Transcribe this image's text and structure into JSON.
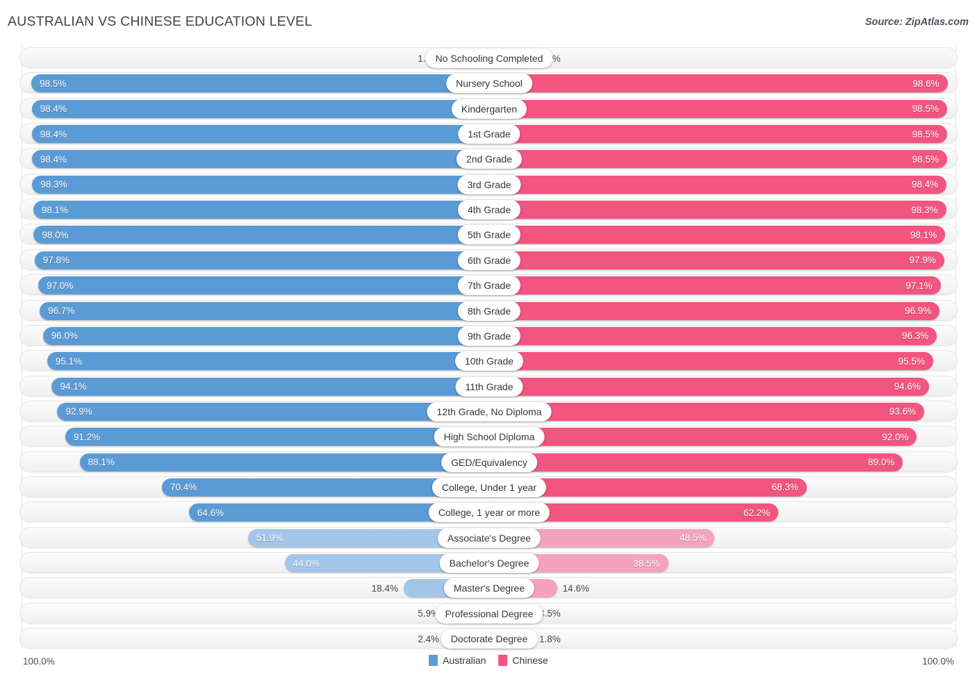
{
  "header": {
    "title": "AUSTRALIAN VS CHINESE EDUCATION LEVEL",
    "source": "Source: ZipAtlas.com"
  },
  "footer": {
    "axis_left": "100.0%",
    "axis_right": "100.0%",
    "legend": [
      {
        "label": "Australian",
        "color": "#5b9bd5"
      },
      {
        "label": "Chinese",
        "color": "#f2557f"
      }
    ]
  },
  "colors": {
    "australian_strong": "#5b9bd5",
    "australian_light": "#a3c6e8",
    "chinese_strong": "#f2557f",
    "chinese_light": "#f4a2bf",
    "track": "#f4f4f4",
    "label_bg": "#ffffff"
  },
  "chart_data": {
    "type": "bar",
    "subtype": "diverging-paired-bar",
    "title": "AUSTRALIAN VS CHINESE EDUCATION LEVEL",
    "xlabel": "",
    "ylabel": "",
    "xlim": [
      0,
      100
    ],
    "grid": true,
    "legend_position": "bottom-center",
    "categories": [
      "No Schooling Completed",
      "Nursery School",
      "Kindergarten",
      "1st Grade",
      "2nd Grade",
      "3rd Grade",
      "4th Grade",
      "5th Grade",
      "6th Grade",
      "7th Grade",
      "8th Grade",
      "9th Grade",
      "10th Grade",
      "11th Grade",
      "12th Grade, No Diploma",
      "High School Diploma",
      "GED/Equivalency",
      "College, Under 1 year",
      "College, 1 year or more",
      "Associate's Degree",
      "Bachelor's Degree",
      "Master's Degree",
      "Professional Degree",
      "Doctorate Degree"
    ],
    "series": [
      {
        "name": "Australian",
        "side": "left",
        "color": "#5b9bd5",
        "values": [
          1.6,
          98.5,
          98.4,
          98.4,
          98.4,
          98.3,
          98.1,
          98.0,
          97.8,
          97.0,
          96.7,
          96.0,
          95.1,
          94.1,
          92.9,
          91.2,
          88.1,
          70.4,
          64.6,
          51.9,
          44.0,
          18.4,
          5.9,
          2.4
        ],
        "labels": [
          "1.6%",
          "98.5%",
          "98.4%",
          "98.4%",
          "98.4%",
          "98.3%",
          "98.1%",
          "98.0%",
          "97.8%",
          "97.0%",
          "96.7%",
          "96.0%",
          "95.1%",
          "94.1%",
          "92.9%",
          "91.2%",
          "88.1%",
          "70.4%",
          "64.6%",
          "51.9%",
          "44.0%",
          "18.4%",
          "5.9%",
          "2.4%"
        ]
      },
      {
        "name": "Chinese",
        "side": "right",
        "color": "#f2557f",
        "values": [
          1.5,
          98.6,
          98.5,
          98.5,
          98.5,
          98.4,
          98.3,
          98.1,
          97.9,
          97.1,
          96.9,
          96.3,
          95.5,
          94.6,
          93.6,
          92.0,
          89.0,
          68.3,
          62.2,
          48.5,
          38.5,
          14.6,
          4.5,
          1.8
        ],
        "labels": [
          "1.5%",
          "98.6%",
          "98.5%",
          "98.5%",
          "98.5%",
          "98.4%",
          "98.3%",
          "98.1%",
          "97.9%",
          "97.1%",
          "96.9%",
          "96.3%",
          "95.5%",
          "94.6%",
          "93.6%",
          "92.0%",
          "89.0%",
          "68.3%",
          "62.2%",
          "48.5%",
          "38.5%",
          "14.6%",
          "4.5%",
          "1.8%"
        ]
      }
    ]
  }
}
